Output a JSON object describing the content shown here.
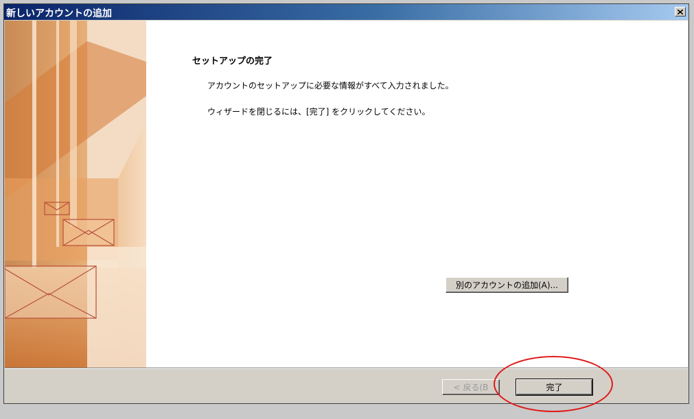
{
  "window": {
    "title": "新しいアカウントの追加",
    "close_icon": "close-icon"
  },
  "content": {
    "heading": "セットアップの完了",
    "paragraph1": "アカウントのセットアップに必要な情報がすべて入力されました。",
    "paragraph2": "ウィザードを閉じるには、[完了] をクリックしてください。",
    "add_account_button": "別のアカウントの追加(A)...",
    "side_image": "mail-envelopes-banner"
  },
  "footer": {
    "back_button": "< 戻る(B",
    "finish_button": "完了"
  },
  "colors": {
    "title_start": "#0a246a",
    "title_end": "#a6caf0",
    "annotation": "#e01818",
    "banner_orange": "#d9823a"
  }
}
